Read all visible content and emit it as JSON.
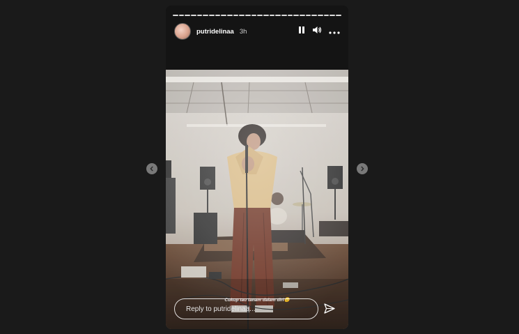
{
  "story": {
    "username": "putridelinaa",
    "time_ago": "3h",
    "segment_count": 28,
    "caption": "Cukup tau tanam dalam diri😊",
    "reply_placeholder": "Reply to putridelinaa..."
  },
  "icons": {
    "pause": "pause-icon",
    "volume": "volume-icon",
    "more": "more-icon",
    "send": "send-icon",
    "prev": "chevron-left-icon",
    "next": "chevron-right-icon"
  }
}
